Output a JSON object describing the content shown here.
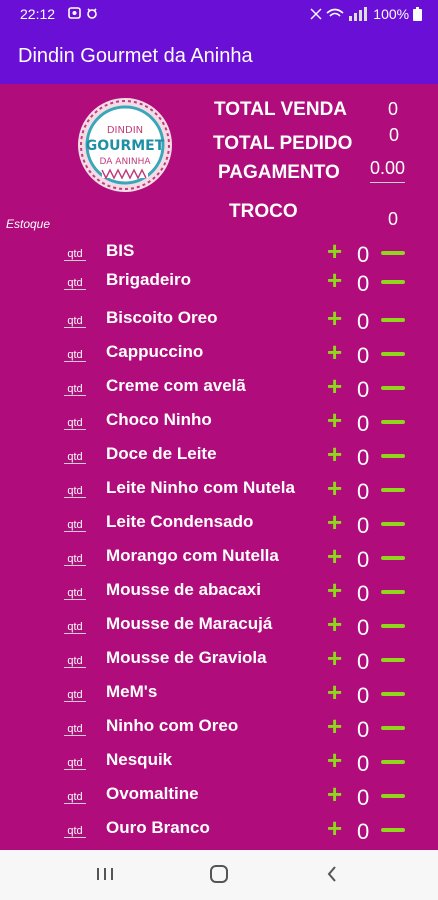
{
  "status_bar": {
    "time": "22:12",
    "battery": "100%"
  },
  "appbar": {
    "title": "Dindin Gourmet da Aninha"
  },
  "logo": {
    "line1": "DINDIN",
    "line2": "GOURMET",
    "line3": "DA ANINHA"
  },
  "totals": {
    "total_venda_label": "TOTAL VENDA",
    "total_venda_value": "0",
    "total_pedido_label": "TOTAL PEDIDO",
    "total_pedido_value": "0",
    "pagamento_label": "PAGAMENTO",
    "pagamento_value": "0.00",
    "troco_label": "TROCO",
    "troco_value": "0"
  },
  "estoque_label": "Estoque",
  "qtd_label": "qtd",
  "items": [
    {
      "name": "BIS",
      "count": "0"
    },
    {
      "name": "Brigadeiro",
      "count": "0"
    },
    {
      "name": "Biscoito Oreo",
      "count": "0"
    },
    {
      "name": "Cappuccino",
      "count": "0"
    },
    {
      "name": "Creme com avelã",
      "count": "0"
    },
    {
      "name": "Choco Ninho",
      "count": "0"
    },
    {
      "name": "Doce de Leite",
      "count": "0"
    },
    {
      "name": "Leite Ninho com Nutela",
      "count": "0"
    },
    {
      "name": "Leite Condensado",
      "count": "0"
    },
    {
      "name": "Morango com Nutella",
      "count": "0"
    },
    {
      "name": "Mousse de abacaxi",
      "count": "0"
    },
    {
      "name": "Mousse de Maracujá",
      "count": "0"
    },
    {
      "name": "Mousse de Graviola",
      "count": "0"
    },
    {
      "name": "MeM's",
      "count": "0"
    },
    {
      "name": "Ninho com Oreo",
      "count": "0"
    },
    {
      "name": "Nesquik",
      "count": "0"
    },
    {
      "name": "Ovomaltine",
      "count": "0"
    },
    {
      "name": "Ouro Branco",
      "count": "0"
    }
  ],
  "colors": {
    "appbar": "#6a0fd6",
    "background": "#b00c7b",
    "accent": "#8fd61c"
  }
}
